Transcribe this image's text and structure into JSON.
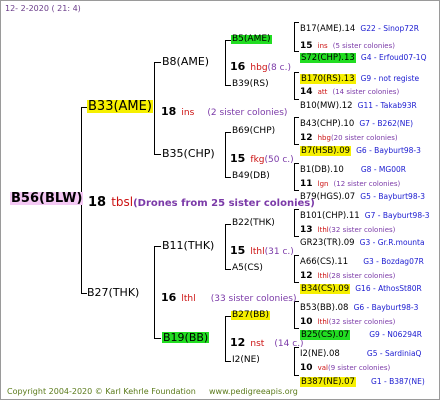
{
  "header": {
    "date": "12-  2-2020  ( 21:  4)"
  },
  "footer": {
    "copyright": "Copyright 2004-2020 © Karl Kehrle Foundation",
    "site": "www.pedigreeapis.org"
  },
  "colors": {
    "yellow": "#f6f000",
    "green": "#22dd22",
    "pink": "#f4c8f4",
    "race": "#cc1111",
    "sisters": "#7b3aa8",
    "link": "#1a1ad0"
  },
  "root": {
    "name": "B56(BLW)",
    "num": "18",
    "race": "tbsl",
    "sisters": "(Drones from 25 sister colonies)"
  },
  "gen1": [
    {
      "name": "B33(AME)",
      "num": "18",
      "race": "ins",
      "sisters": "(2 sister colonies)"
    },
    {
      "name": "B27(THK)",
      "num": "16",
      "race": "lthl",
      "sisters": "(33 sister colonies)"
    }
  ],
  "gen2": [
    {
      "name": "B8(AME)",
      "num": "16",
      "race": "hbg",
      "sisters": "(8 c.)"
    },
    {
      "name": "B35(CHP)",
      "num": "15",
      "race": "fkg",
      "sisters": "(50 c.)"
    },
    {
      "name": "B11(THK)",
      "num": "15",
      "race": "lthl",
      "sisters": "(31 c.)"
    },
    {
      "name": "B19(BB)",
      "num": "12",
      "race": "nst",
      "sisters": "(14 c.)"
    }
  ],
  "gen3": [
    {
      "name": "B5(AME)",
      "num": "15",
      "race": "ins",
      "sisters": "(5 sister colonies)"
    },
    {
      "name": "B39(RS)",
      "num": "14",
      "race": "att",
      "sisters": "(14 sister colonies)"
    },
    {
      "name": "B69(CHP)",
      "num": "12",
      "race": "hbg",
      "sisters": "(20 sister colonies)"
    },
    {
      "name": "B49(DB)",
      "num": "11",
      "race": "lgn",
      "sisters": "(12 sister colonies)"
    },
    {
      "name": "B22(THK)",
      "num": "13",
      "race": "lthl",
      "sisters": "(32 sister colonies)"
    },
    {
      "name": "A5(CS)",
      "num": "12",
      "race": "lthl",
      "sisters": "(28 sister colonies)"
    },
    {
      "name": "B27(BB)",
      "num": "10",
      "race": "lthl",
      "sisters": "(32 sister colonies)"
    },
    {
      "name": "I2(NE)",
      "num": "10",
      "race": "val",
      "sisters": "(9 sister colonies)"
    }
  ],
  "gen4": [
    {
      "name": "B17(AME).14",
      "ref": "G22 - Sinop72R"
    },
    {
      "name": "S72(CHP).13",
      "ref": "G4 - Erfoud07-1Q"
    },
    {
      "name": "B170(RS).13",
      "ref": "G9 - not registe"
    },
    {
      "name": "B10(MW).12",
      "ref": "G11 - Takab93R"
    },
    {
      "name": "B43(CHP).10",
      "ref": "G7 - B262(NE)"
    },
    {
      "name": "B7(HSB).09",
      "ref": "G6 - Bayburt98-3"
    },
    {
      "name": "B1(DB).10",
      "ref": "G8 - MG00R"
    },
    {
      "name": "B79(HGS).07",
      "ref": "G5 - Bayburt98-3"
    },
    {
      "name": "B101(CHP).11",
      "ref": "G7 - Bayburt98-3"
    },
    {
      "name": "GR23(TR).09",
      "ref": "G3 - Gr.R.mounta"
    },
    {
      "name": "A66(CS).11",
      "ref": "G3 - Bozdag07R"
    },
    {
      "name": "B34(CS).09",
      "ref": "G16 - AthosSt80R"
    },
    {
      "name": "B53(BB).08",
      "ref": "G6 - Bayburt98-3"
    },
    {
      "name": "B25(CS).07",
      "ref": "G9 - N06294R"
    },
    {
      "name": "I2(NE).08",
      "ref": "G5 - SardiniaQ"
    },
    {
      "name": "B387(NE).07",
      "ref": "G1 - B387(NE)"
    }
  ]
}
